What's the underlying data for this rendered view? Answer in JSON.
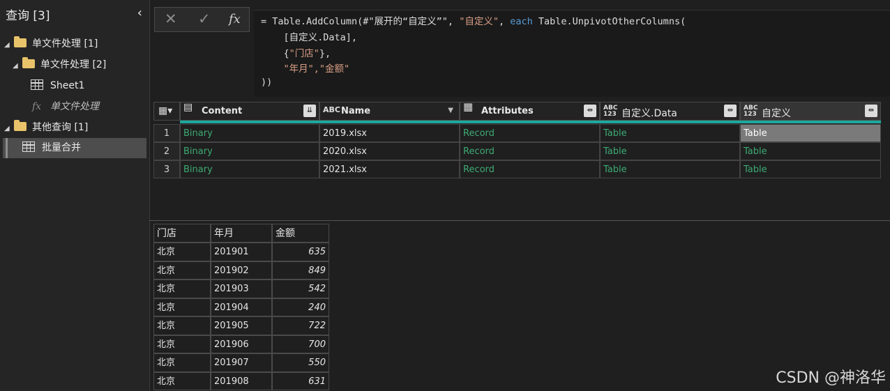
{
  "queries_pane": {
    "title": "查询 [3]",
    "collapse_icon": "‹",
    "tree": [
      {
        "label": "单文件处理 [1]",
        "type": "folder"
      },
      {
        "label": "单文件处理 [2]",
        "type": "folder"
      },
      {
        "label": "Sheet1",
        "type": "table"
      },
      {
        "label": "单文件处理",
        "type": "function"
      },
      {
        "label": "其他查询 [1]",
        "type": "folder"
      },
      {
        "label": "批量合并",
        "type": "table",
        "selected": true
      }
    ]
  },
  "formula_bar": {
    "cancel_icon": "✕",
    "confirm_icon": "✓",
    "fx_icon": "fx",
    "line1_prefix": "= Table.AddColumn(#\"展开的“自定义”\", ",
    "line1_str": "\"自定义\"",
    "line1_mid": ", ",
    "line1_kw": "each",
    "line1_suffix": " Table.UnpivotOtherColumns(",
    "line2": "    [自定义.Data],",
    "line3_open": "    {",
    "line3_str": "\"门店\"",
    "line3_close": "},",
    "line4": "    \"年月\",\"金额\"",
    "line5": "))"
  },
  "grid": {
    "columns": [
      {
        "name": "Content",
        "type_icon": "▤",
        "action": "expand"
      },
      {
        "name": "Name",
        "type_icon": "ABC",
        "action": "dropdown"
      },
      {
        "name": "Attributes",
        "type_icon": "▦",
        "action": "expand"
      },
      {
        "name": "自定义.Data",
        "type_icon": "ABC 123",
        "action": "expand"
      },
      {
        "name": "自定义",
        "type_icon": "ABC 123",
        "action": "expand"
      }
    ],
    "rows": [
      {
        "num": "1",
        "cells": [
          "Binary",
          "2019.xlsx",
          "Record",
          "Table",
          "Table"
        ]
      },
      {
        "num": "2",
        "cells": [
          "Binary",
          "2020.xlsx",
          "Record",
          "Table",
          "Table"
        ]
      },
      {
        "num": "3",
        "cells": [
          "Binary",
          "2021.xlsx",
          "Record",
          "Table",
          "Table"
        ]
      }
    ]
  },
  "preview": {
    "headers": [
      "门店",
      "年月",
      "金额"
    ],
    "rows": [
      [
        "北京",
        "201901",
        "635"
      ],
      [
        "北京",
        "201902",
        "849"
      ],
      [
        "北京",
        "201903",
        "542"
      ],
      [
        "北京",
        "201904",
        "240"
      ],
      [
        "北京",
        "201905",
        "722"
      ],
      [
        "北京",
        "201906",
        "700"
      ],
      [
        "北京",
        "201907",
        "550"
      ],
      [
        "北京",
        "201908",
        "631"
      ]
    ]
  },
  "watermark": "CSDN @神洛华",
  "colors": {
    "accent_teal": "#1fa89a",
    "value_green": "#3daa74",
    "string_orange": "#d69d85",
    "keyword_blue": "#569cd6"
  }
}
